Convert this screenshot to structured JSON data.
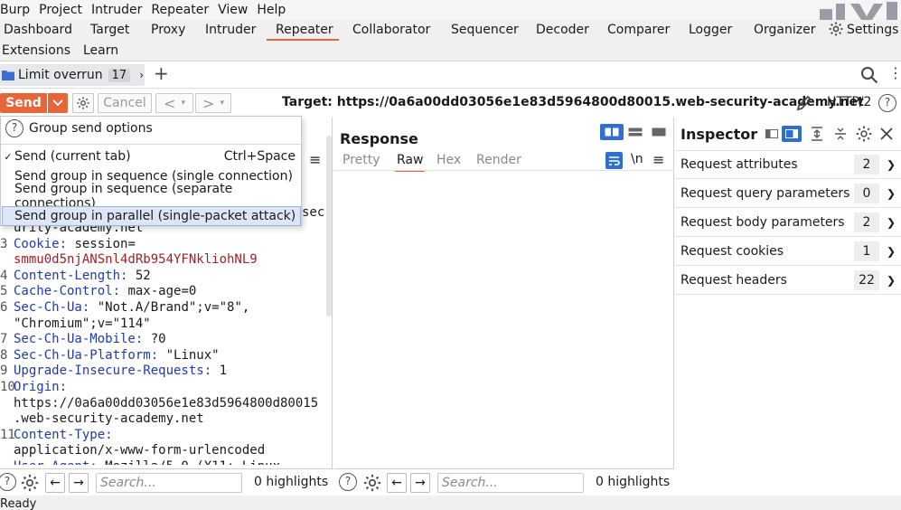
{
  "menubar": {
    "items": [
      "Burp",
      "Project",
      "Intruder",
      "Repeater",
      "View",
      "Help"
    ]
  },
  "main_tabs": {
    "row1": [
      "Dashboard",
      "Target",
      "Proxy",
      "Intruder",
      "Repeater",
      "Collaborator",
      "Sequencer",
      "Decoder",
      "Comparer",
      "Logger",
      "Organizer",
      "Settings"
    ],
    "row2": [
      "Extensions",
      "Learn"
    ],
    "active": "Repeater"
  },
  "repeater_tab": {
    "label": "Limit overrun",
    "count": "17",
    "add": "+"
  },
  "toolbar": {
    "send": "Send",
    "cancel": "Cancel",
    "target_label": "Target: https://0a6a00dd03056e1e83d5964800d80015.web-security-academy.net",
    "protocol": "HTTP/2"
  },
  "dropdown": {
    "header": "Group send options",
    "items": [
      {
        "label": "Send (current tab)",
        "shortcut": "Ctrl+Space",
        "check": "✓"
      },
      {
        "label": "Send group in sequence (single connection)"
      },
      {
        "label": "Send group in sequence (separate connections)"
      },
      {
        "label": "Send group in parallel (single-packet attack)"
      }
    ]
  },
  "request": {
    "partial_line1": "sec",
    "partial_line2": "urity-academy.net",
    "lines": [
      {
        "n": "3",
        "key": "Cookie:",
        "val": " session="
      },
      {
        "n": "",
        "key": "",
        "val": "smmu0d5njANSnl4dRb954YFNkliohNL9",
        "red": true
      },
      {
        "n": "4",
        "key": "Content-Length:",
        "val": " 52"
      },
      {
        "n": "5",
        "key": "Cache-Control:",
        "val": " max-age=0"
      },
      {
        "n": "6",
        "key": "Sec-Ch-Ua:",
        "val": " \"Not.A/Brand\";v=\"8\","
      },
      {
        "n": "",
        "key": "",
        "val": "\"Chromium\";v=\"114\""
      },
      {
        "n": "7",
        "key": "Sec-Ch-Ua-Mobile:",
        "val": " ?0"
      },
      {
        "n": "8",
        "key": "Sec-Ch-Ua-Platform:",
        "val": " \"Linux\""
      },
      {
        "n": "9",
        "key": "Upgrade-Insecure-Requests:",
        "val": " 1"
      },
      {
        "n": "10",
        "key": "Origin:",
        "val": ""
      },
      {
        "n": "",
        "key": "",
        "val": "https://0a6a00dd03056e1e83d5964800d80015"
      },
      {
        "n": "",
        "key": "",
        "val": ".web-security-academy.net"
      },
      {
        "n": "11",
        "key": "Content-Type:",
        "val": ""
      },
      {
        "n": "",
        "key": "",
        "val": "application/x-www-form-urlencoded"
      },
      {
        "n": "",
        "key": "User-Agent:",
        "val": " Mozilla/5.0 (X11; Linux"
      }
    ],
    "search_placeholder": "Search...",
    "highlights": "0 highlights"
  },
  "response": {
    "title": "Response",
    "tabs": [
      "Pretty",
      "Raw",
      "Hex",
      "Render"
    ],
    "active_tab": "Raw",
    "newline_toggle": "\\n",
    "search_placeholder": "Search...",
    "highlights": "0 highlights"
  },
  "inspector": {
    "title": "Inspector",
    "rows": [
      {
        "label": "Request attributes",
        "count": "2"
      },
      {
        "label": "Request query parameters",
        "count": "0"
      },
      {
        "label": "Request body parameters",
        "count": "2"
      },
      {
        "label": "Request cookies",
        "count": "1"
      },
      {
        "label": "Request headers",
        "count": "22"
      }
    ]
  },
  "status": {
    "text": "Ready"
  },
  "colors": {
    "accent": "#e8653a",
    "header_key": "#1f3ca8",
    "cookie_value": "#a3212a",
    "view_toggle": "#2f6fd1"
  }
}
